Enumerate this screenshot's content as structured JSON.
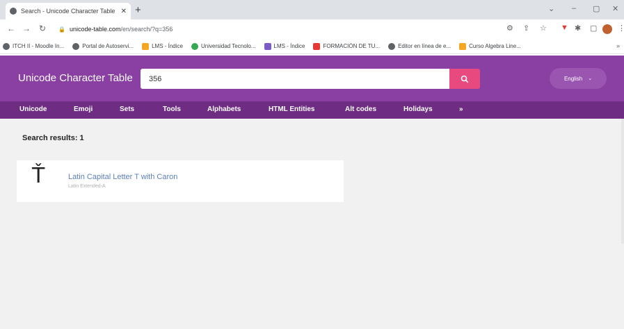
{
  "browser": {
    "tab_title": "Search - Unicode Character Table",
    "tab_close": "✕",
    "new_tab": "+",
    "window_controls": [
      "⌄",
      "–",
      "▢",
      "✕"
    ],
    "address": {
      "host": "unicode-table.com",
      "path": "/en/search/?q=356"
    },
    "bookmarks": [
      {
        "label": "ITCH II - Moodle In...",
        "color": "#5f6368"
      },
      {
        "label": "Portal de Autoservi...",
        "color": "#5f6368"
      },
      {
        "label": "LMS - Índice",
        "color": "#f5a623"
      },
      {
        "label": "Universidad Tecnolo...",
        "color": "#34a853"
      },
      {
        "label": "LMS - Índice",
        "color": "#7b5cc4"
      },
      {
        "label": "FORMACIÓN DE TU...",
        "color": "#e53935"
      },
      {
        "label": "Editor en línea de e...",
        "color": "#5f6368"
      },
      {
        "label": "Curso Algebra Line...",
        "color": "#f5a623"
      }
    ],
    "bookmarks_more": "»"
  },
  "site": {
    "brand": "Unicode Character Table",
    "search_value": "356",
    "language": "English",
    "nav": [
      "Unicode",
      "Emoji",
      "Sets",
      "Tools",
      "Alphabets",
      "HTML Entities",
      "Alt codes",
      "Holidays",
      "»"
    ],
    "colors": {
      "header": "#8a3fa3",
      "nav": "#6e2c83",
      "search_button": "#e84a7f",
      "link": "#5b7fbf"
    }
  },
  "results": {
    "title": "Search results: 1",
    "items": [
      {
        "glyph": "Ť",
        "name": "Latin Capital Letter T with Caron",
        "block": "Latin Extended-A"
      }
    ]
  }
}
